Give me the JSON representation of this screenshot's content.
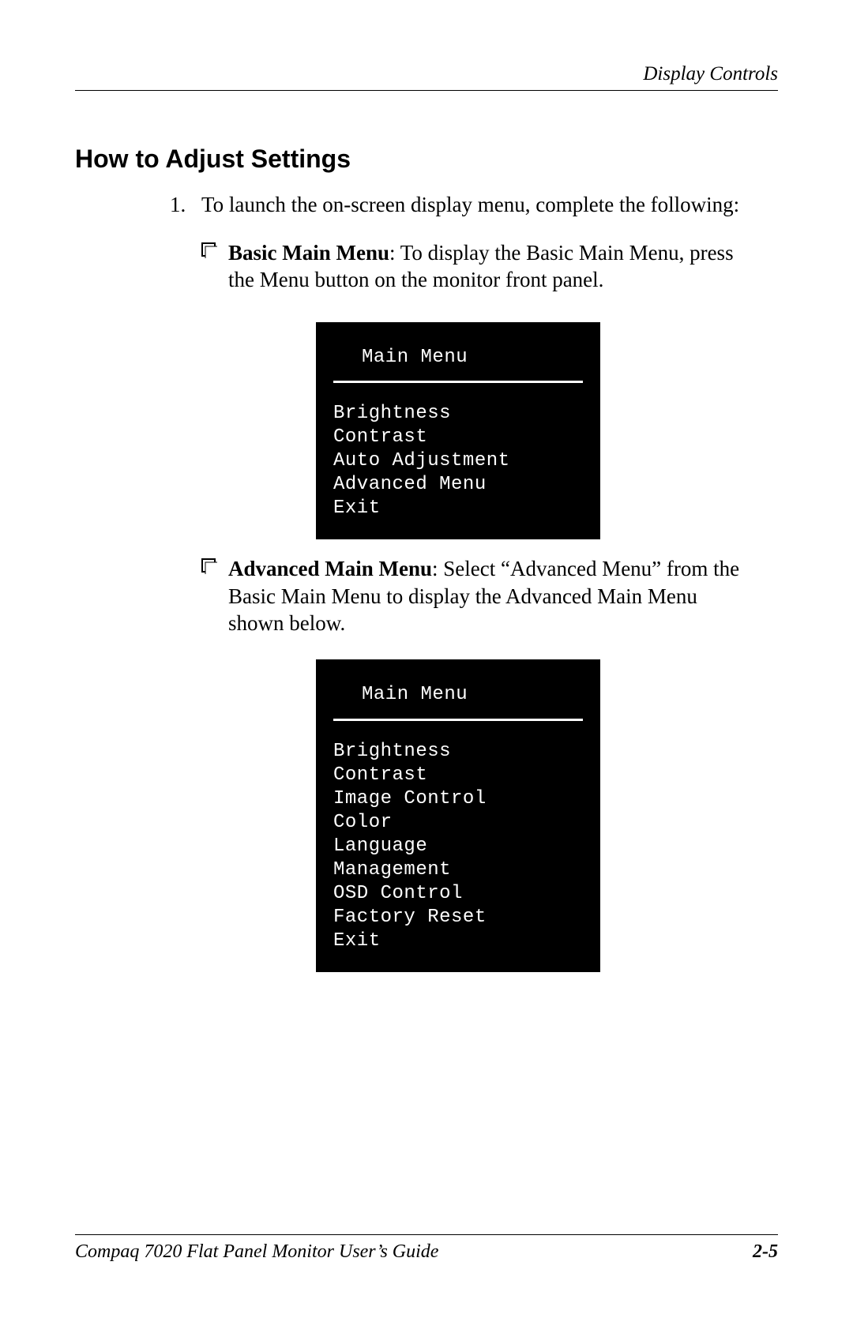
{
  "header": {
    "section_name": "Display Controls"
  },
  "body": {
    "section_title": "How to Adjust Settings",
    "step1_number": "1.",
    "step1_text": "To launch the on-screen display menu, complete the following:",
    "bullet_a_bold": "Basic Main Menu",
    "bullet_a_rest": ": To display the Basic Main Menu, press the Menu button on the monitor front panel.",
    "bullet_b_bold": "Advanced Main Menu",
    "bullet_b_rest": ": Select “Advanced Menu” from the Basic Main Menu to display the Advanced Main Menu shown below."
  },
  "osd_basic": {
    "title": "Main Menu",
    "items": [
      "Brightness",
      "Contrast",
      "Auto Adjustment",
      "Advanced Menu",
      "Exit"
    ]
  },
  "osd_advanced": {
    "title": "Main Menu",
    "items": [
      "Brightness",
      "Contrast",
      "Image Control",
      "Color",
      "Language",
      "Management",
      "OSD Control",
      "Factory Reset",
      "Exit"
    ]
  },
  "footer": {
    "guide_title": "Compaq 7020 Flat Panel Monitor User’s Guide",
    "page_number": "2-5"
  }
}
